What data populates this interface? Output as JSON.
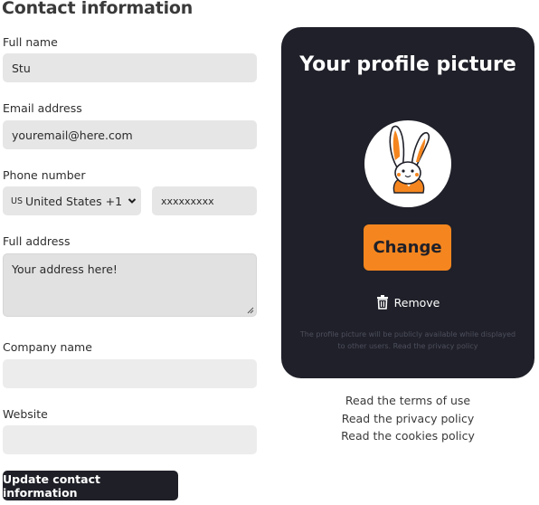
{
  "form": {
    "heading": "Contact information",
    "full_name": {
      "label": "Full name",
      "value": "Stu"
    },
    "email": {
      "label": "Email address",
      "value": "youremail@here.com"
    },
    "phone": {
      "label": "Phone number",
      "country_code": "US",
      "country_name": "United States +1",
      "number": "xxxxxxxxx"
    },
    "address": {
      "label": "Full address",
      "value": "Your address here!"
    },
    "company": {
      "label": "Company name",
      "value": ""
    },
    "website": {
      "label": "Website",
      "value": ""
    },
    "submit_label": "Update contact information"
  },
  "profile": {
    "title": "Your profile picture",
    "avatar_icon": "rabbit-mascot-icon",
    "change_label": "Change",
    "remove_label": "Remove",
    "note": "The profile picture will be publicly available while displayed to other users. Read the privacy policy"
  },
  "links": {
    "terms": "Read the terms of use",
    "privacy": "Read the privacy policy",
    "cookies": "Read the cookies policy"
  },
  "colors": {
    "card_bg": "#1f2029",
    "accent": "#f5861f",
    "field_bg": "#e6e6e6",
    "button_dark": "#1e1f27"
  }
}
